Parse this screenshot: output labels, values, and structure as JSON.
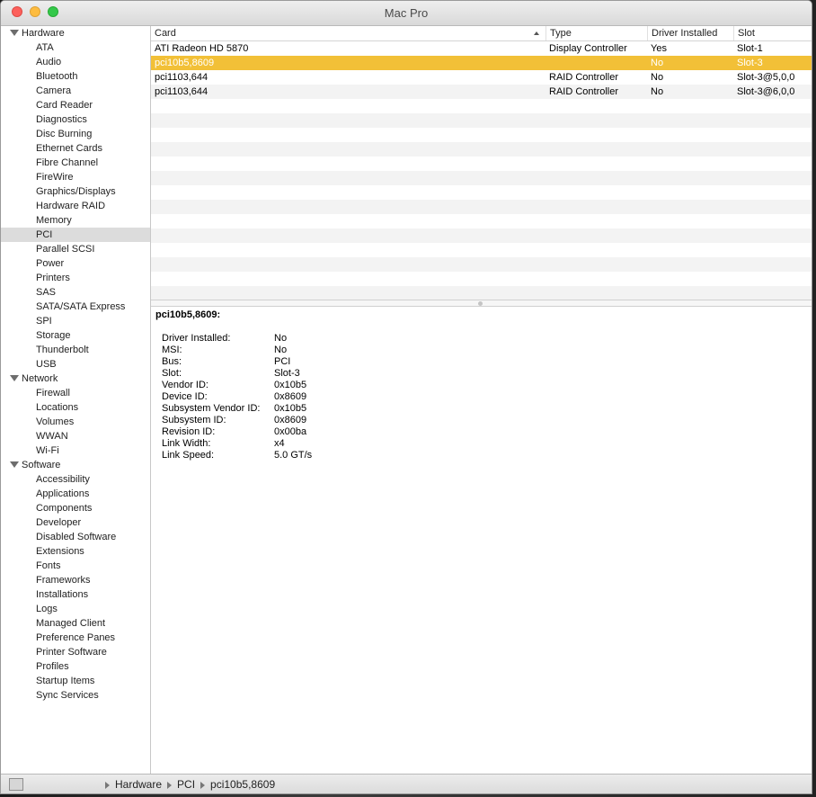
{
  "window": {
    "title": "Mac Pro"
  },
  "sidebar": {
    "groups": [
      {
        "label": "Hardware",
        "items": [
          "ATA",
          "Audio",
          "Bluetooth",
          "Camera",
          "Card Reader",
          "Diagnostics",
          "Disc Burning",
          "Ethernet Cards",
          "Fibre Channel",
          "FireWire",
          "Graphics/Displays",
          "Hardware RAID",
          "Memory",
          "PCI",
          "Parallel SCSI",
          "Power",
          "Printers",
          "SAS",
          "SATA/SATA Express",
          "SPI",
          "Storage",
          "Thunderbolt",
          "USB"
        ]
      },
      {
        "label": "Network",
        "items": [
          "Firewall",
          "Locations",
          "Volumes",
          "WWAN",
          "Wi-Fi"
        ]
      },
      {
        "label": "Software",
        "items": [
          "Accessibility",
          "Applications",
          "Components",
          "Developer",
          "Disabled Software",
          "Extensions",
          "Fonts",
          "Frameworks",
          "Installations",
          "Logs",
          "Managed Client",
          "Preference Panes",
          "Printer Software",
          "Profiles",
          "Startup Items",
          "Sync Services"
        ]
      }
    ],
    "selected": "PCI"
  },
  "table": {
    "columns": [
      "Card",
      "Type",
      "Driver Installed",
      "Slot"
    ],
    "rows": [
      [
        "ATI Radeon HD 5870",
        "Display Controller",
        "Yes",
        "Slot-1"
      ],
      [
        "pci10b5,8609",
        "",
        "No",
        "Slot-3"
      ],
      [
        "pci1103,644",
        "RAID Controller",
        "No",
        "Slot-3@5,0,0"
      ],
      [
        "pci1103,644",
        "RAID Controller",
        "No",
        "Slot-3@6,0,0"
      ]
    ],
    "selected_row": 1
  },
  "detail": {
    "title": "pci10b5,8609:",
    "properties": [
      {
        "key": "Driver Installed:",
        "value": "No"
      },
      {
        "key": "MSI:",
        "value": "No"
      },
      {
        "key": "Bus:",
        "value": "PCI"
      },
      {
        "key": "Slot:",
        "value": "Slot-3"
      },
      {
        "key": "Vendor ID:",
        "value": "0x10b5"
      },
      {
        "key": "Device ID:",
        "value": "0x8609"
      },
      {
        "key": "Subsystem Vendor ID:",
        "value": "0x10b5"
      },
      {
        "key": "Subsystem ID:",
        "value": "0x8609"
      },
      {
        "key": "Revision ID:",
        "value": "0x00ba"
      },
      {
        "key": "Link Width:",
        "value": "x4"
      },
      {
        "key": "Link Speed:",
        "value": "5.0 GT/s"
      }
    ]
  },
  "breadcrumb": [
    "Hardware",
    "PCI",
    "pci10b5,8609"
  ],
  "colors": {
    "selection": "#f2c037",
    "sidebar_selected": "#dcdcdc"
  }
}
